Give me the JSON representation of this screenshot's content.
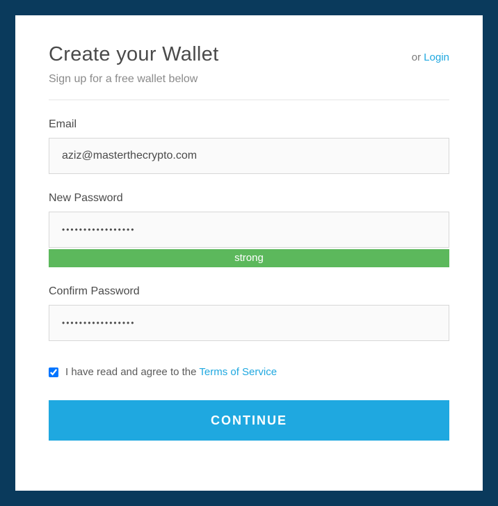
{
  "header": {
    "title": "Create your Wallet",
    "subtitle": "Sign up for a free wallet below",
    "or_text": "or ",
    "login_text": "Login"
  },
  "fields": {
    "email": {
      "label": "Email",
      "value": "aziz@masterthecrypto.com"
    },
    "new_password": {
      "label": "New Password",
      "value": "•••••••••••••••••",
      "strength_label": "strong",
      "strength_color": "#5cb85c"
    },
    "confirm_password": {
      "label": "Confirm Password",
      "value": "•••••••••••••••••"
    }
  },
  "tos": {
    "checked": true,
    "prefix": "I have read and agree to the ",
    "link_text": "Terms of Service"
  },
  "submit": {
    "label": "CONTINUE"
  }
}
